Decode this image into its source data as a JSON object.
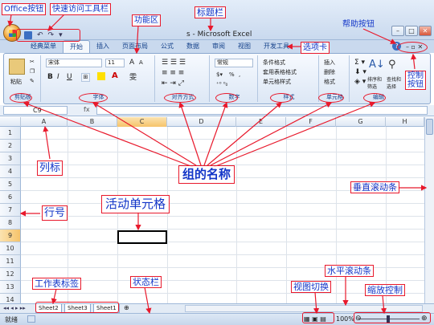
{
  "window": {
    "title": "s - Microsoft Excel"
  },
  "tabs": [
    "经典菜单",
    "开始",
    "插入",
    "页面布局",
    "公式",
    "数据",
    "审阅",
    "视图",
    "开发工具"
  ],
  "ribbon": {
    "font_name": "宋体",
    "font_size": "11",
    "number_format": "常规",
    "paste": "粘贴",
    "bold": "B",
    "italic": "I",
    "underline": "U",
    "grow_font": "A",
    "shrink_font": "A",
    "pct": "%",
    "comma": ",",
    "conditional_format": "条件格式",
    "table_format": "套用表格格式",
    "cell_style": "单元格样式",
    "insert": "插入",
    "delete": "删除",
    "format": "格式",
    "sort_filter": "排序和\n筛选",
    "find_select": "查找和\n选择",
    "groups": [
      "剪贴板",
      "字体",
      "对齐方式",
      "数字",
      "样式",
      "单元格",
      "编辑"
    ]
  },
  "formula_bar": {
    "name_box": "C9",
    "fx": "fx"
  },
  "columns": [
    "A",
    "B",
    "C",
    "D",
    "E",
    "F",
    "G",
    "H"
  ],
  "rows": [
    "1",
    "2",
    "3",
    "4",
    "5",
    "6",
    "7",
    "8",
    "9",
    "10",
    "11",
    "12",
    "13",
    "14"
  ],
  "sheets": [
    "Sheet2",
    "Sheet3",
    "Sheet1"
  ],
  "status": {
    "ready": "就绪",
    "zoom": "100%"
  },
  "annotations": {
    "office_button": "Office按钮",
    "quick_access": "快速访问工具栏",
    "ribbon": "功能区",
    "title_bar": "标题栏",
    "help_button": "帮助按钮",
    "tab": "选项卡",
    "control_button": "控制\n按钮",
    "column_label": "列标",
    "group_name": "组的名称",
    "vertical_scroll": "垂直滚动条",
    "active_cell": "活动单元格",
    "row_number": "行号",
    "sheet_tab": "工作表标签",
    "status_bar": "状态栏",
    "view_switch": "视图切换",
    "horizontal_scroll": "水平滚动条",
    "zoom_control": "缩放控制"
  },
  "colors": {
    "annotation_border": "#e8192c",
    "annotation_text": "#1336c8",
    "ribbon_blue": "#c9d9ee"
  }
}
